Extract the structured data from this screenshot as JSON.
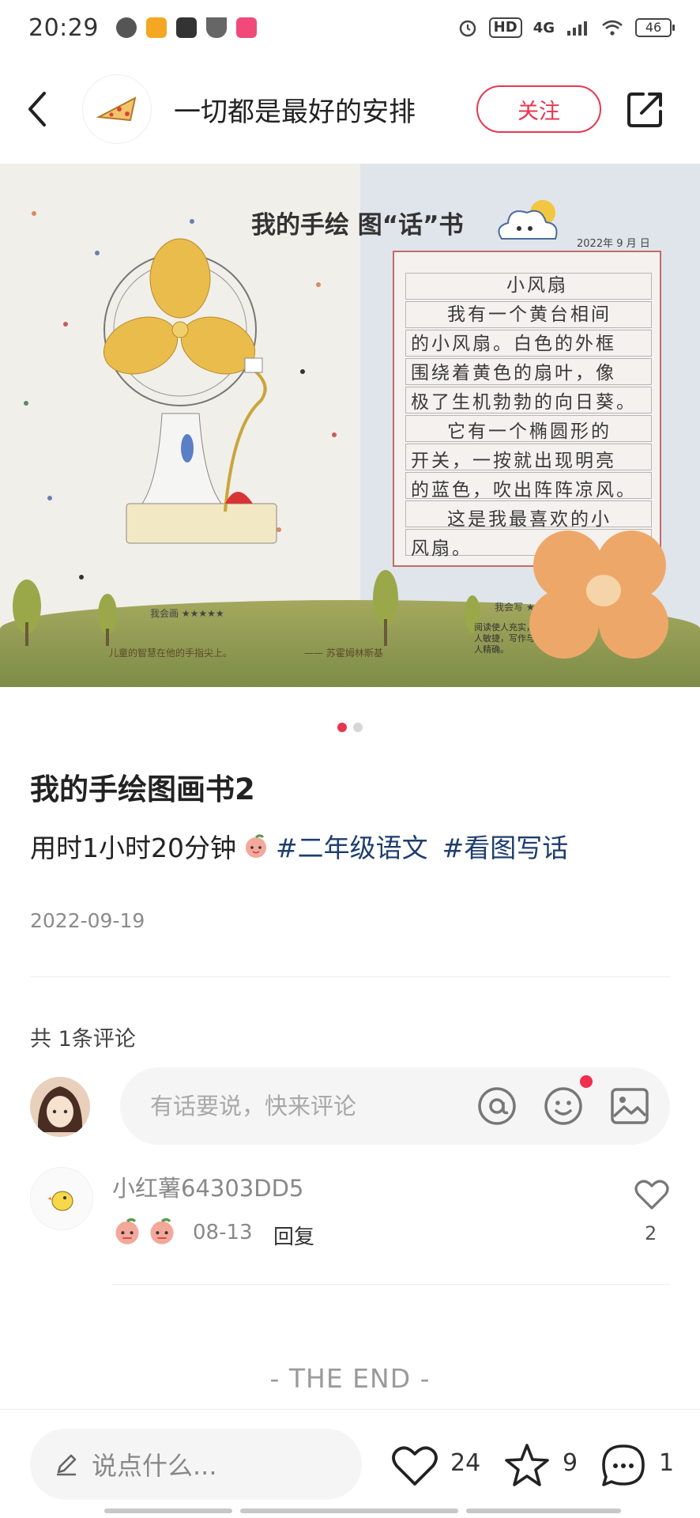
{
  "status_bar": {
    "time": "20:29",
    "hd": "HD",
    "network": "4G",
    "battery": "46"
  },
  "header": {
    "author": "一切都是最好的安排",
    "follow_label": "关注"
  },
  "photo": {
    "book_title": "我的手绘 图“话”书",
    "date_line": "2022年 9 月 日",
    "essay_title": "小风扇",
    "essay_lines": [
      "我有一个黄台相间",
      "的小风扇。白色的外框",
      "围绕着黄色的扇叶，像",
      "极了生机勃勃的向日葵。",
      "它有一个椭圆形的",
      "开关，一按就出现明亮",
      "的蓝色，吹出阵阵凉风。",
      "这是我最喜欢的小",
      "风扇。"
    ],
    "rating_left": "我会画 ★★★★★",
    "rating_right": "我会写 ★★",
    "caption_left": "儿童的智慧在他的手指尖上。",
    "caption_attrib": "—— 苏霍姆林斯基",
    "caption_right": "阅读使人充实，会谈使人敏捷，写作与笔记使人精确。"
  },
  "pager": {
    "count": 2,
    "active": 0
  },
  "post": {
    "title": "我的手绘图画书2",
    "desc_text": "用时1小时20分钟",
    "tags": [
      "#二年级语文",
      "#看图写话"
    ],
    "date": "2022-09-19"
  },
  "comments": {
    "count_label": "共 1条评论",
    "input_placeholder": "有话要说，快来评论",
    "items": [
      {
        "user": "小红薯64303DD5",
        "date": "08-13",
        "reply_label": "回复",
        "likes": "2"
      }
    ]
  },
  "end_label": "- THE END -",
  "bottom_bar": {
    "say_placeholder": "说点什么...",
    "likes": "24",
    "stars": "9",
    "comments": "1"
  },
  "colors": {
    "accent": "#e8364f",
    "tag": "#1e3e6e",
    "muted": "#8b8b8b"
  }
}
